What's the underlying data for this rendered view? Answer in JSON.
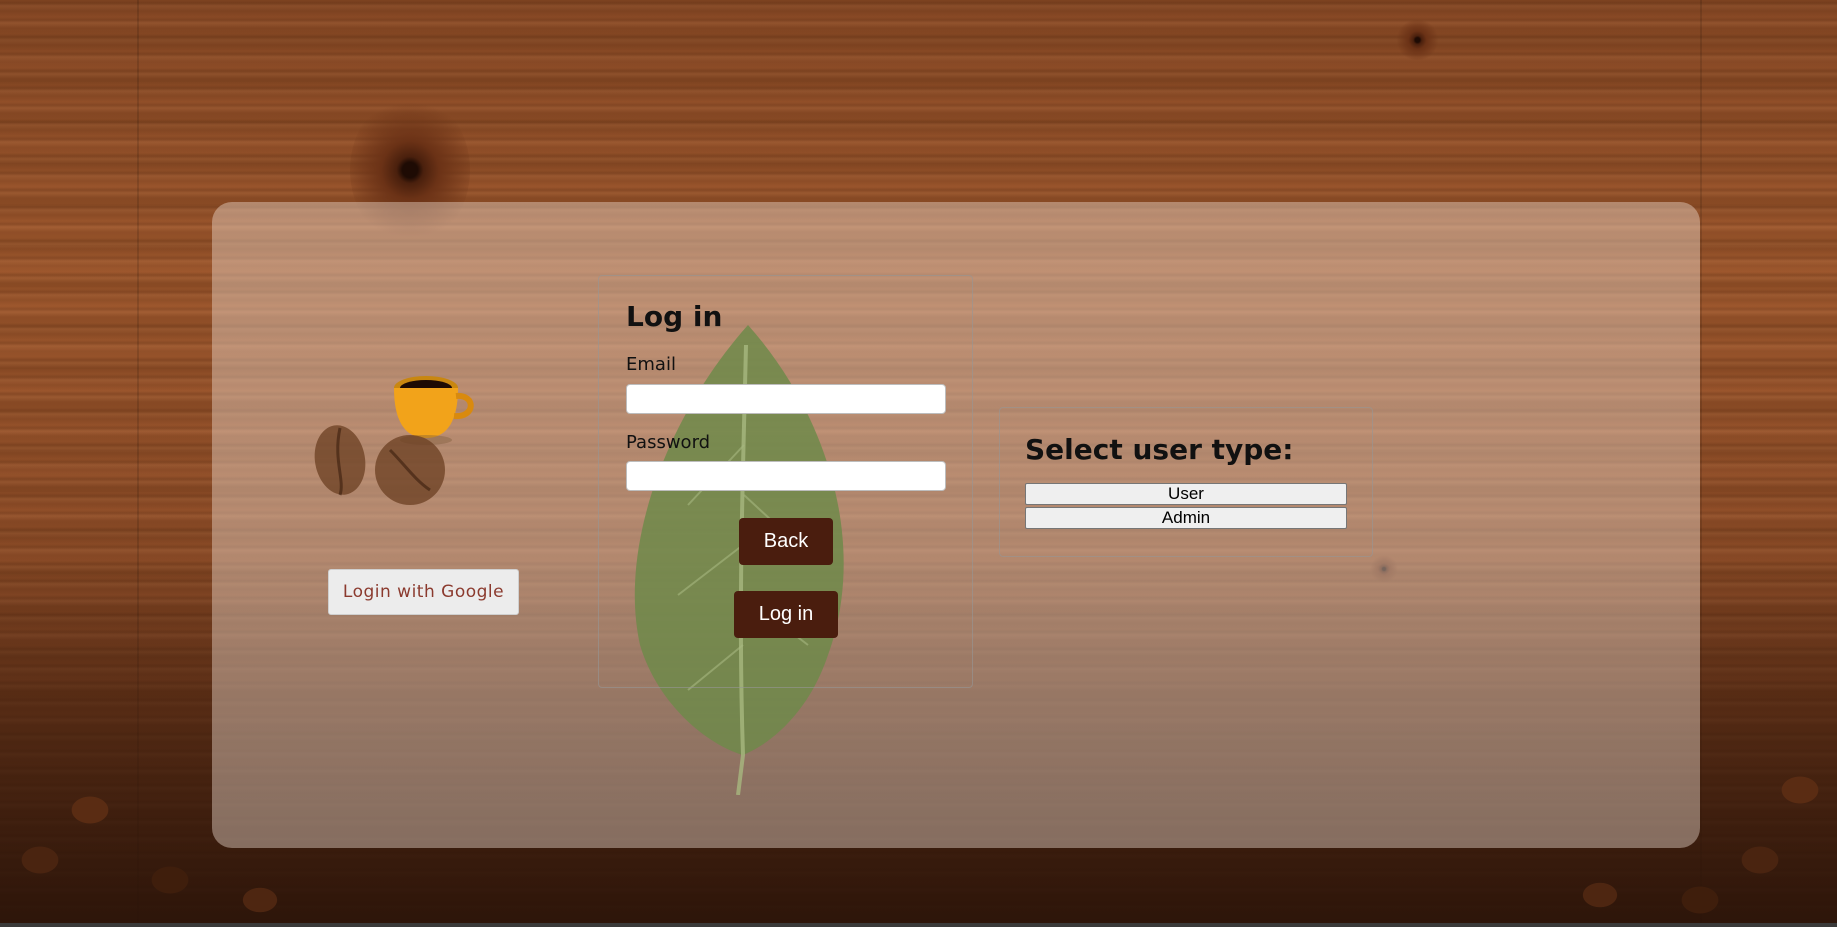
{
  "login": {
    "title": "Log in",
    "email_label": "Email",
    "email_value": "",
    "password_label": "Password",
    "password_value": "",
    "back_label": "Back",
    "login_label": "Log in"
  },
  "google": {
    "label": "Login with Google"
  },
  "user_type": {
    "title": "Select user type:",
    "options": [
      "User",
      "Admin"
    ]
  },
  "colors": {
    "button_brown": "#4a1d0e",
    "google_text": "#8b3a2e",
    "panel_tint": "rgba(240,225,212,0.42)"
  },
  "icons": {
    "cup": "coffee-cup-icon",
    "leaf": "leaf-decoration",
    "beans": "coffee-beans-decoration"
  }
}
